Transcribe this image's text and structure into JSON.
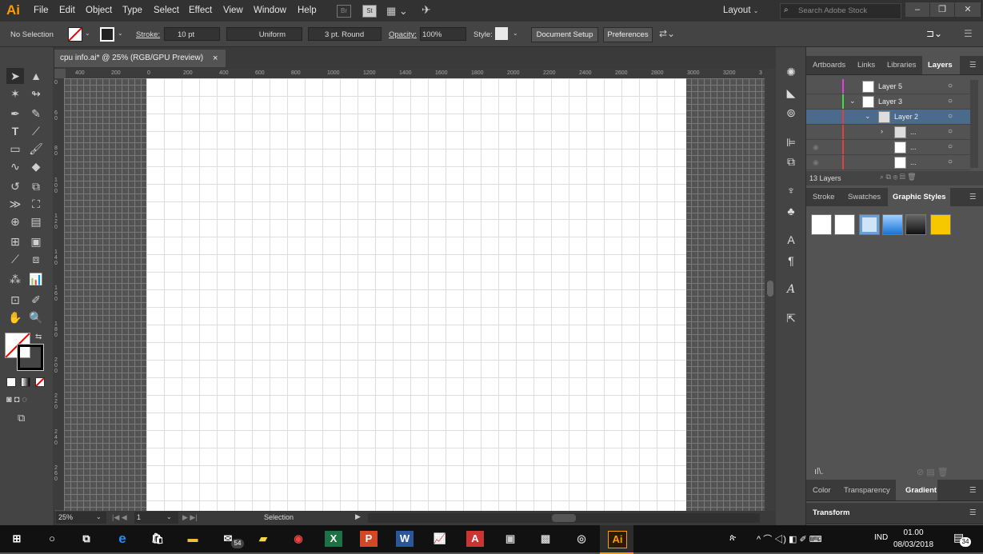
{
  "app": {
    "logo": "Ai",
    "menus": [
      "File",
      "Edit",
      "Object",
      "Type",
      "Select",
      "Effect",
      "View",
      "Window",
      "Help"
    ],
    "br": "Br",
    "st": "St",
    "workspace": "Layout",
    "search_placeholder": "Search Adobe Stock"
  },
  "control": {
    "selection": "No Selection",
    "stroke_label": "Stroke:",
    "stroke_value": "10 pt",
    "profile": "Uniform",
    "brush": "3 pt. Round",
    "opacity_label": "Opacity:",
    "opacity_value": "100%",
    "style_label": "Style:",
    "doc_setup": "Document Setup",
    "preferences": "Preferences"
  },
  "document": {
    "tab_title": "cpu info.ai* @ 25% (RGB/GPU Preview)",
    "close": "×",
    "hruler": [
      "400",
      "200",
      "0",
      "200",
      "400",
      "600",
      "800",
      "1000",
      "1200",
      "1400",
      "1600",
      "1800",
      "2000",
      "2200",
      "2400",
      "2600",
      "2800",
      "3000",
      "3200",
      "3"
    ],
    "vruler": [
      "0",
      "6\n0",
      "8\n0",
      "1\n0\n0",
      "1\n2\n0",
      "1\n4\n0",
      "1\n6\n0",
      "1\n8\n0",
      "2\n0\n0",
      "2\n2\n0",
      "2\n4\n0",
      "2\n6\n0"
    ]
  },
  "status": {
    "zoom": "25%",
    "artboard": "1",
    "tool": "Selection"
  },
  "layers_panel": {
    "tabs": [
      "Artboards",
      "Links",
      "Libraries",
      "Layers"
    ],
    "rows": [
      {
        "name": "Layer 5",
        "color": "#e040e0"
      },
      {
        "name": "Layer 3",
        "color": "#40e040"
      },
      {
        "name": "Layer 2",
        "color": "#e04040"
      },
      {
        "name": "...",
        "color": "#e04040"
      },
      {
        "name": "...",
        "color": "#e04040"
      },
      {
        "name": "...",
        "color": "#e04040"
      }
    ],
    "count": "13 Layers"
  },
  "graphic_styles_panel": {
    "tabs": [
      "Stroke",
      "Swatches",
      "Graphic Styles"
    ]
  },
  "color_panel": {
    "tabs": [
      "Color",
      "Transparency",
      "Gradient"
    ]
  },
  "transform_panel": {
    "title": "Transform"
  },
  "taskbar": {
    "mail_badge": "54",
    "lang": "IND",
    "time": "01.00",
    "date": "08/03/2018",
    "notif": "34"
  },
  "colors": {
    "accent": "#ff9a00",
    "selected_layer": "#4b6a8c"
  }
}
